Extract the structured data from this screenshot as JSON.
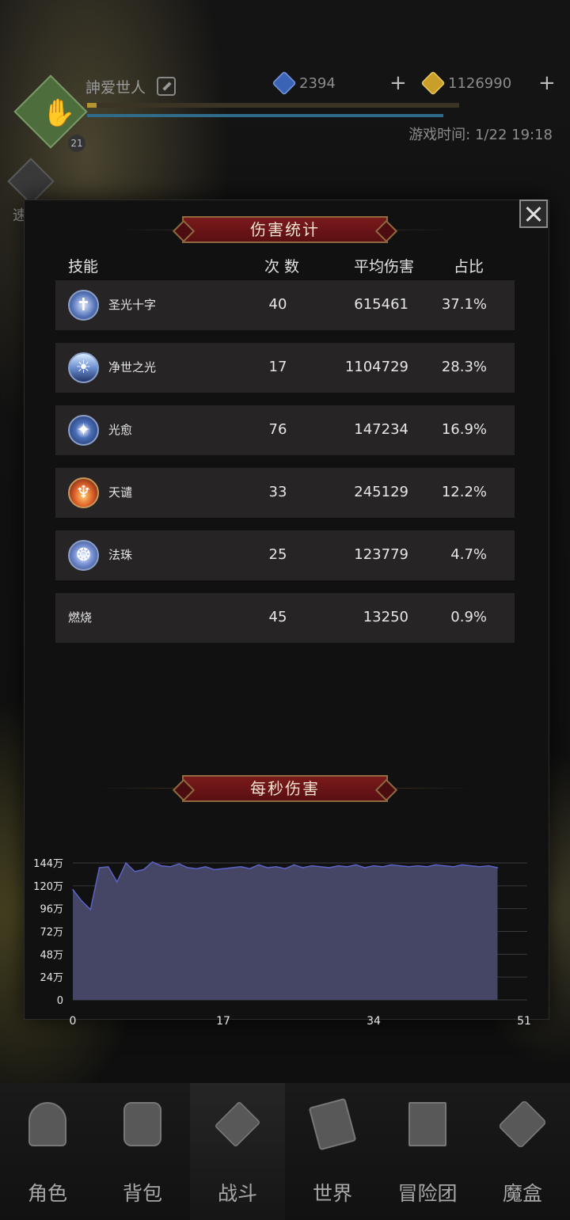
{
  "header": {
    "player_name": "訷爱世人",
    "level": "21",
    "gems": "2394",
    "gold": "1126990",
    "game_time": "游戏时间: 1/22 19:18",
    "side_button": "速战"
  },
  "dialog": {
    "damage_title": "伤害统计",
    "columns": {
      "skill": "技能",
      "count": "次 数",
      "avg": "平均伤害",
      "ratio": "占比"
    },
    "rows": [
      {
        "icon": "holy-cross-icon",
        "name": "圣光十字",
        "count": "40",
        "avg": "615461",
        "ratio": "37.1%"
      },
      {
        "icon": "purifying-light-icon",
        "name": "净世之光",
        "count": "17",
        "avg": "1104729",
        "ratio": "28.3%"
      },
      {
        "icon": "healing-light-icon",
        "name": "光愈",
        "count": "76",
        "avg": "147234",
        "ratio": "16.9%"
      },
      {
        "icon": "divine-judgment-icon",
        "name": "天谴",
        "count": "33",
        "avg": "245129",
        "ratio": "12.2%"
      },
      {
        "icon": "magic-orb-icon",
        "name": "法珠",
        "count": "25",
        "avg": "123779",
        "ratio": "4.7%"
      },
      {
        "icon": "",
        "name": "燃烧",
        "count": "45",
        "avg": "13250",
        "ratio": "0.9%"
      }
    ],
    "dps_title": "每秒伤害"
  },
  "chart_data": {
    "type": "area",
    "title": "每秒伤害",
    "y_ticks": [
      "0",
      "24万",
      "48万",
      "72万",
      "96万",
      "120万",
      "144万"
    ],
    "x_ticks": [
      "0",
      "17",
      "34",
      "51"
    ],
    "ylim": [
      0,
      1440000
    ],
    "xlim": [
      0,
      51
    ],
    "fill_color": "#454665",
    "line_color": "#5b63c4",
    "x": [
      0,
      1,
      2,
      3,
      4,
      5,
      6,
      7,
      8,
      9,
      10,
      11,
      12,
      13,
      14,
      15,
      16,
      17,
      18,
      19,
      20,
      21,
      22,
      23,
      24,
      25,
      26,
      27,
      28,
      29,
      30,
      31,
      32,
      33,
      34,
      35,
      36,
      37,
      38,
      39,
      40,
      41,
      42,
      43,
      44,
      45,
      46,
      47,
      48
    ],
    "y": [
      1160000,
      1040000,
      950000,
      1390000,
      1400000,
      1240000,
      1440000,
      1350000,
      1370000,
      1450000,
      1410000,
      1400000,
      1430000,
      1390000,
      1380000,
      1400000,
      1370000,
      1380000,
      1390000,
      1400000,
      1380000,
      1420000,
      1390000,
      1400000,
      1380000,
      1420000,
      1390000,
      1410000,
      1400000,
      1390000,
      1410000,
      1400000,
      1420000,
      1390000,
      1410000,
      1400000,
      1420000,
      1410000,
      1400000,
      1410000,
      1400000,
      1420000,
      1410000,
      1400000,
      1420000,
      1410000,
      1400000,
      1410000,
      1390000
    ]
  },
  "nav": {
    "items": [
      {
        "label": "角色",
        "icon": "helmet-icon"
      },
      {
        "label": "背包",
        "icon": "backpack-icon"
      },
      {
        "label": "战斗",
        "icon": "swords-icon",
        "active": true
      },
      {
        "label": "世界",
        "icon": "map-scroll-icon"
      },
      {
        "label": "冒险团",
        "icon": "castle-icon"
      },
      {
        "label": "魔盒",
        "icon": "magic-cube-icon"
      }
    ]
  }
}
